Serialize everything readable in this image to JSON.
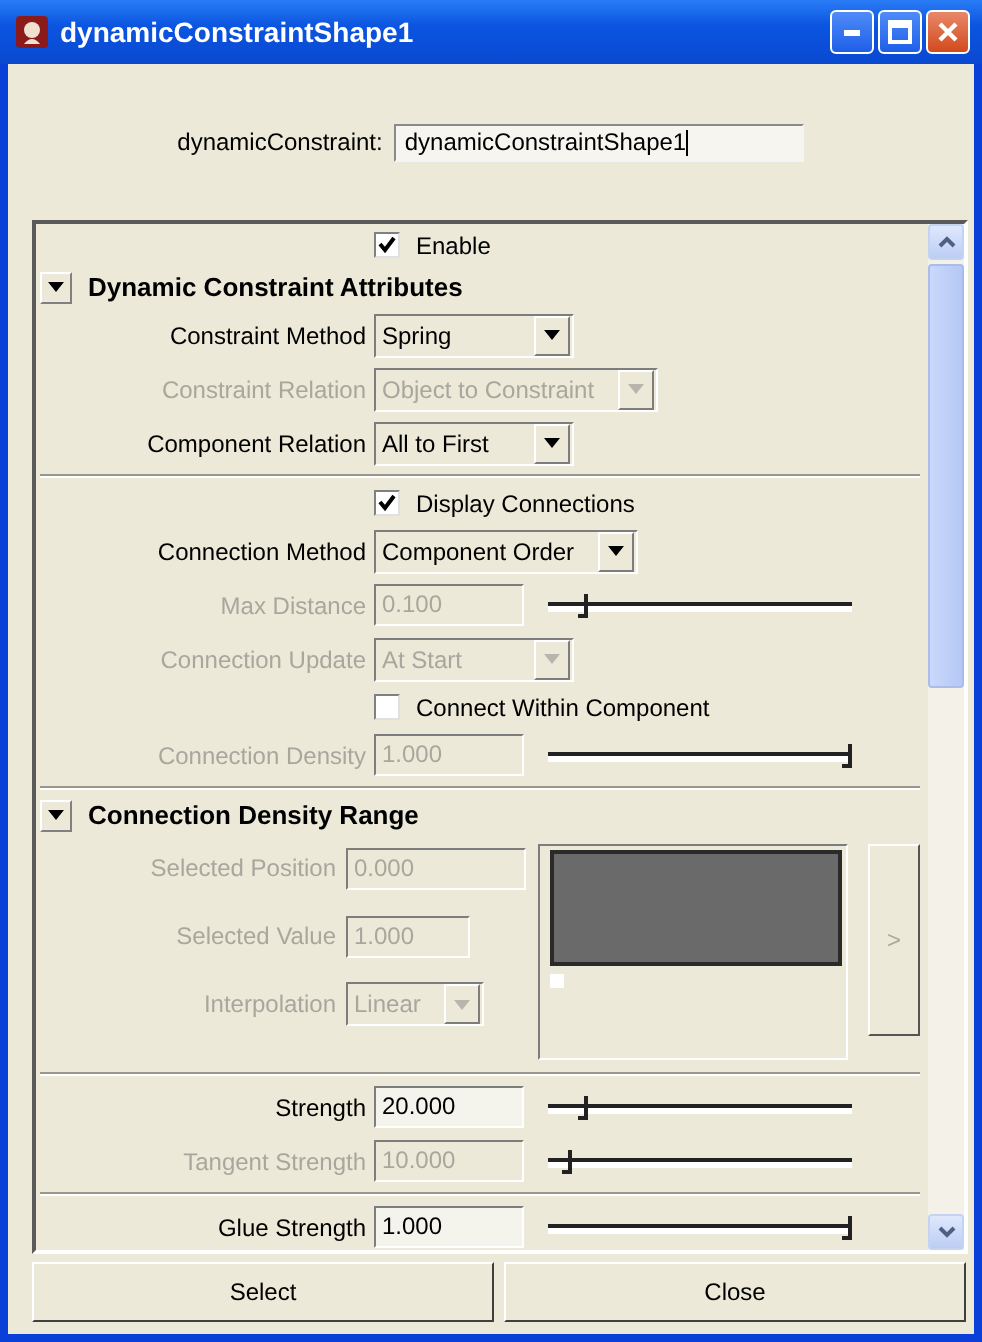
{
  "window": {
    "title": "dynamicConstraintShape1"
  },
  "name_field": {
    "label": "dynamicConstraint:",
    "value": "dynamicConstraintShape1"
  },
  "groups": [
    {
      "rows": [
        {
          "kind": "checkbox",
          "label": "Enable",
          "checked": true,
          "disabled": false
        }
      ]
    },
    {
      "header": {
        "title": "Dynamic Constraint Attributes",
        "expanded": true
      },
      "rows": [
        {
          "kind": "dropdown",
          "label": "Constraint Method",
          "value": "Spring",
          "disabled": false
        },
        {
          "kind": "dropdown",
          "label": "Constraint Relation",
          "value": "Object to Constraint",
          "disabled": true
        },
        {
          "kind": "dropdown",
          "label": "Component Relation",
          "value": "All to First",
          "disabled": false
        }
      ]
    },
    {
      "rows": [
        {
          "kind": "checkbox",
          "label": "Display Connections",
          "checked": true,
          "disabled": false
        },
        {
          "kind": "dropdown",
          "label": "Connection Method",
          "value": "Component Order",
          "disabled": false
        },
        {
          "kind": "slider",
          "label": "Max Distance",
          "value": "0.100",
          "level": 0.1,
          "disabled": true
        },
        {
          "kind": "dropdown",
          "label": "Connection Update",
          "value": "At Start",
          "disabled": true
        },
        {
          "kind": "checkbox",
          "label": "Connect Within Component",
          "checked": false,
          "disabled": false
        },
        {
          "kind": "slider",
          "label": "Connection Density",
          "value": "1.000",
          "level": 1,
          "disabled": true
        }
      ]
    },
    {
      "header": {
        "title": "Connection Density Range",
        "expanded": true
      },
      "rows": [
        {
          "kind": "ramp",
          "fields": [
            {
              "kind": "field",
              "label": "Selected Position",
              "value": "0.000",
              "disabled": true
            },
            {
              "kind": "field",
              "label": "Selected Value",
              "value": "1.000",
              "disabled": true
            },
            {
              "kind": "dropdown",
              "label": "Interpolation",
              "value": "Linear",
              "disabled": true
            }
          ],
          "expand_label": ">"
        }
      ]
    },
    {
      "rows": [
        {
          "kind": "slider",
          "label": "Strength",
          "value": "20.000",
          "level": 0.1,
          "disabled": false
        },
        {
          "kind": "slider",
          "label": "Tangent Strength",
          "value": "10.000",
          "level": 0.05,
          "disabled": true
        }
      ]
    },
    {
      "rows": [
        {
          "kind": "slider",
          "label": "Glue Strength",
          "value": "1.000",
          "level": 1,
          "disabled": false
        }
      ]
    }
  ],
  "buttons": [
    "Select",
    "Close"
  ]
}
